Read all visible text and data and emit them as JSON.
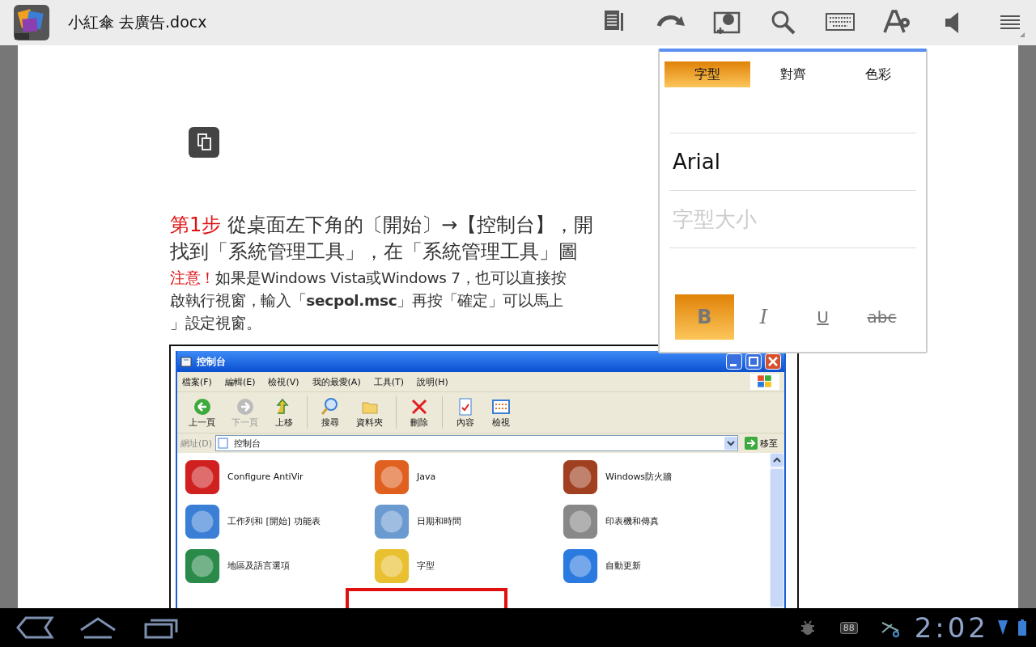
{
  "app_bar": {
    "title": "小紅傘 去廣告.docx"
  },
  "document": {
    "step": {
      "lead": "第1步",
      "lines": [
        "從桌面左下角的〔開始〕→【控制台】，開",
        "找到「系統管理工具」，在「系統管理工具」圖"
      ]
    },
    "note": {
      "lead": "注意！",
      "lines": [
        "如果是Windows Vista或Windows 7，也可以直接按",
        "啟執行視窗，輸入「**secpol.msc**」再按「確定」可以馬上",
        "」設定視窗。"
      ]
    },
    "figure": {
      "window_title": "控制台",
      "menu": [
        "檔案(F)",
        "編輯(E)",
        "檢視(V)",
        "我的最愛(A)",
        "工具(T)",
        "說明(H)"
      ],
      "toolbar": [
        {
          "kind": "back",
          "label": "上一頁",
          "disabled": false
        },
        {
          "kind": "forward",
          "label": "下一頁",
          "disabled": true
        },
        {
          "kind": "up",
          "label": "上移",
          "disabled": false
        },
        {
          "kind": "search",
          "label": "搜尋",
          "disabled": false
        },
        {
          "kind": "folders",
          "label": "資料夾",
          "disabled": false
        },
        {
          "kind": "delete",
          "label": "刪除",
          "disabled": false
        },
        {
          "kind": "properties",
          "label": "內容",
          "disabled": false
        },
        {
          "kind": "views",
          "label": "檢視",
          "disabled": false
        }
      ],
      "address": {
        "label": "網址(D)",
        "value": "控制台",
        "go": "移至"
      },
      "items": [
        "Configure AntiVir",
        "Java",
        "Windows防火牆",
        "工作列和 [開始] 功能表",
        "日期和時間",
        "印表機和傳真",
        "地區及語言選項",
        "字型",
        "自動更新"
      ]
    }
  },
  "format_popup": {
    "tabs": [
      {
        "label": "字型",
        "selected": true
      },
      {
        "label": "對齊",
        "selected": false
      },
      {
        "label": "色彩",
        "selected": false
      }
    ],
    "font": {
      "value": "Arial"
    },
    "size": {
      "placeholder": "字型大小"
    },
    "styles": [
      {
        "kind": "bold",
        "label": "B",
        "selected": true
      },
      {
        "kind": "italic",
        "label": "I",
        "selected": false
      },
      {
        "kind": "underline",
        "label": "U",
        "selected": false
      },
      {
        "kind": "strike",
        "label": "abc",
        "selected": false
      }
    ]
  },
  "status_bar": {
    "badge": "88",
    "time": "2:02"
  }
}
